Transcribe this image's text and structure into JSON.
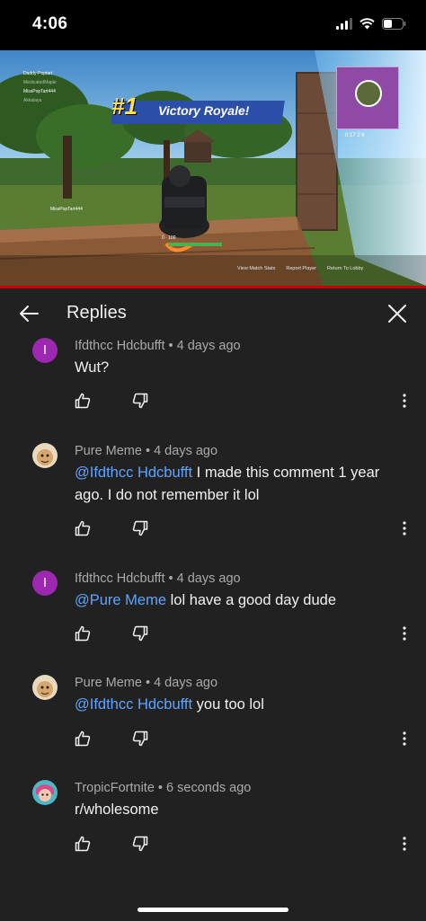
{
  "status_bar": {
    "time": "4:06"
  },
  "video": {
    "banner_rank": "#1",
    "banner_text": "Victory Royale!",
    "player_tag": "MissPopTart444",
    "killfeed": [
      "Daddy-Poptart",
      "MedicatedMaple",
      "MissPopTart444",
      "Akkalaya"
    ],
    "health_text": "0 · 100",
    "minimap_stats": "0:17  2  6",
    "controls": [
      "View Match Stats",
      "Report Player",
      "Return To Lobby"
    ]
  },
  "header": {
    "title": "Replies"
  },
  "comments": [
    {
      "author": "Ifdthcc Hdcbufft",
      "time": "4 days ago",
      "avatar_letter": "I",
      "mention": "",
      "text": "Wut?"
    },
    {
      "author": "Pure Meme",
      "time": "4 days ago",
      "avatar_letter": "",
      "mention": "@Ifdthcc Hdcbufft",
      "text": " I made this comment 1 year ago. I do not remember it lol"
    },
    {
      "author": "Ifdthcc Hdcbufft",
      "time": "4 days ago",
      "avatar_letter": "I",
      "mention": "@Pure Meme",
      "text": " lol have a good day dude"
    },
    {
      "author": "Pure Meme",
      "time": "4 days ago",
      "avatar_letter": "",
      "mention": "@Ifdthcc Hdcbufft",
      "text": " you too lol"
    },
    {
      "author": "TropicFortnite",
      "time": "6 seconds ago",
      "avatar_letter": "",
      "mention": "",
      "text": "r/wholesome"
    }
  ],
  "colors": {
    "background": "#212121",
    "mention": "#5ea5ff",
    "meta": "#aaaaaa",
    "letter_avatar": "#9c27b0",
    "progress": "#cc0000"
  },
  "icons": [
    "back-arrow-icon",
    "close-icon",
    "thumbs-up-icon",
    "thumbs-down-icon",
    "more-vertical-icon"
  ]
}
